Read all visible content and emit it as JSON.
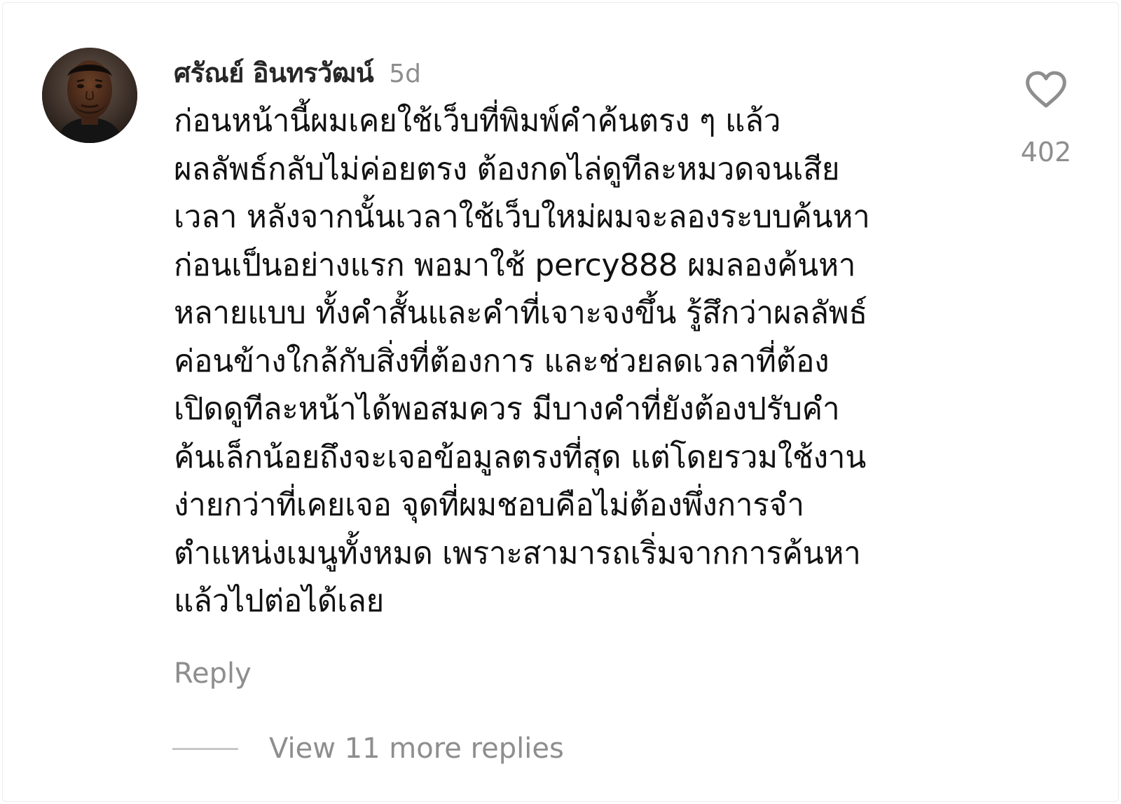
{
  "comment": {
    "author": "ศรัณย์ อินทรวัฒน์",
    "age": "5d",
    "text": "ก่อนหน้านี้ผมเคยใช้เว็บที่พิมพ์คำค้นตรง ๆ แล้ว\nผลลัพธ์กลับไม่ค่อยตรง ต้องกดไล่ดูทีละหมวดจนเสีย\nเวลา หลังจากนั้นเวลาใช้เว็บใหม่ผมจะลองระบบค้นหา\nก่อนเป็นอย่างแรก พอมาใช้ percy888 ผมลองค้นหา\nหลายแบบ ทั้งคำสั้นและคำที่เจาะจงขึ้น รู้สึกว่าผลลัพธ์\nค่อนข้างใกล้กับสิ่งที่ต้องการ และช่วยลดเวลาที่ต้อง\nเปิดดูทีละหน้าได้พอสมควร มีบางคำที่ยังต้องปรับคำ\nค้นเล็กน้อยถึงจะเจอข้อมูลตรงที่สุด แต่โดยรวมใช้งาน\nง่ายกว่าที่เคยเจอ จุดที่ผมชอบคือไม่ต้องพึ่งการจำ\nตำแหน่งเมนูทั้งหมด เพราะสามารถเริ่มจากการค้นหา\nแล้วไปต่อได้เลย",
    "like_count": "402",
    "like_icon": "heart-outline-icon",
    "reply_label": "Reply",
    "view_replies_label": "View 11 more replies"
  },
  "colors": {
    "secondary_text": "#8e8e8e",
    "primary_text": "#111111",
    "background": "#ffffff"
  }
}
